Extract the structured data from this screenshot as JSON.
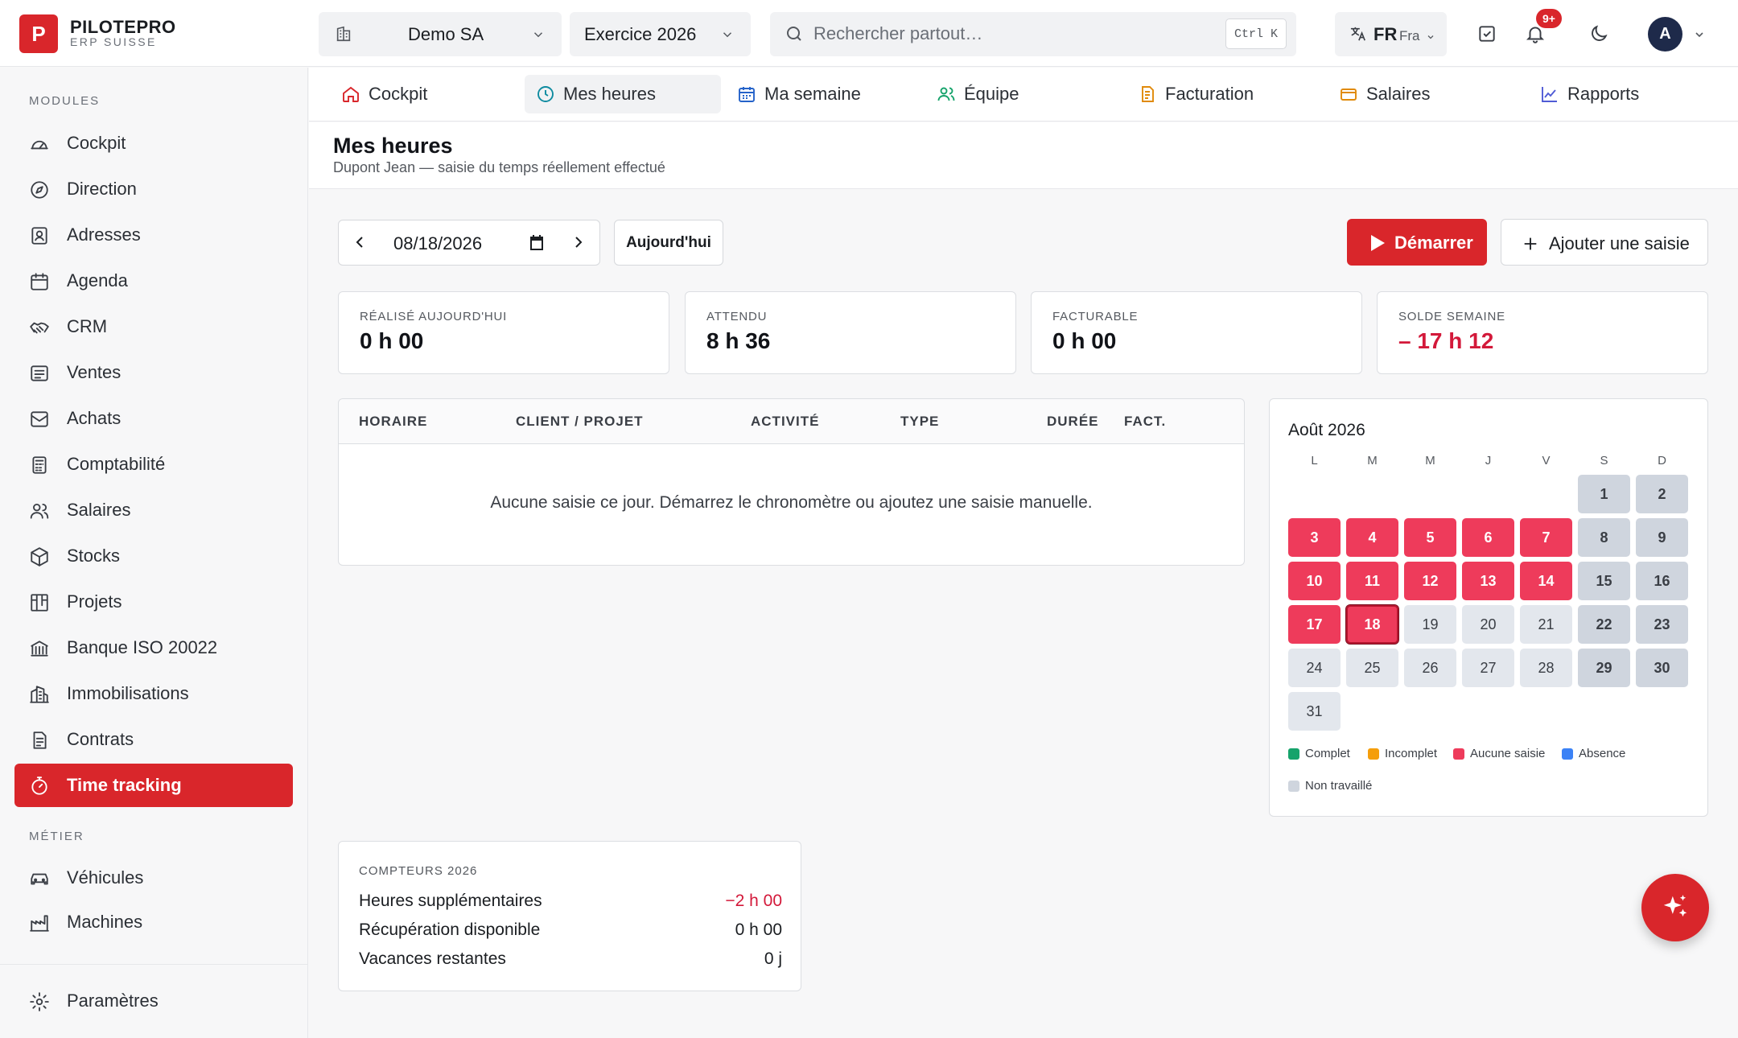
{
  "brand": {
    "logo_letter": "P",
    "name": "PILOTEPRO",
    "subtitle": "ERP SUISSE"
  },
  "topbar": {
    "company": "Demo SA",
    "fiscal_year": "Exercice 2026",
    "search_placeholder": "Rechercher partout…",
    "search_shortcut": "Ctrl K",
    "lang_code": "FR",
    "lang_name": "Fra",
    "notifications_badge": "9+",
    "avatar_initial": "A"
  },
  "sidebar": {
    "section_modules": "MODULES",
    "modules": [
      {
        "label": "Cockpit",
        "icon": "gauge-icon"
      },
      {
        "label": "Direction",
        "icon": "compass-icon"
      },
      {
        "label": "Adresses",
        "icon": "contact-card-icon"
      },
      {
        "label": "Agenda",
        "icon": "calendar-icon"
      },
      {
        "label": "CRM",
        "icon": "handshake-icon"
      },
      {
        "label": "Ventes",
        "icon": "receipt-icon"
      },
      {
        "label": "Achats",
        "icon": "inbox-icon"
      },
      {
        "label": "Comptabilité",
        "icon": "calculator-icon"
      },
      {
        "label": "Salaires",
        "icon": "users-icon"
      },
      {
        "label": "Stocks",
        "icon": "box-icon"
      },
      {
        "label": "Projets",
        "icon": "kanban-icon"
      },
      {
        "label": "Banque ISO 20022",
        "icon": "bank-icon"
      },
      {
        "label": "Immobilisations",
        "icon": "buildings-icon"
      },
      {
        "label": "Contrats",
        "icon": "contract-icon"
      },
      {
        "label": "Time tracking",
        "icon": "stopwatch-icon",
        "active": true
      }
    ],
    "section_metier": "MÉTIER",
    "metier": [
      {
        "label": "Véhicules",
        "icon": "car-icon"
      },
      {
        "label": "Machines",
        "icon": "factory-icon"
      }
    ],
    "settings": "Paramètres"
  },
  "tabs": [
    {
      "label": "Cockpit",
      "icon": "home-icon"
    },
    {
      "label": "Mes heures",
      "icon": "clock-icon",
      "active": true
    },
    {
      "label": "Ma semaine",
      "icon": "calendar-icon"
    },
    {
      "label": "Équipe",
      "icon": "users-icon"
    },
    {
      "label": "Facturation",
      "icon": "document-icon"
    },
    {
      "label": "Salaires",
      "icon": "wallet-icon"
    },
    {
      "label": "Rapports",
      "icon": "chart-line-icon"
    }
  ],
  "page": {
    "title": "Mes heures",
    "subtitle": "Dupont Jean — saisie du temps réellement effectué"
  },
  "toolbar": {
    "date": "08/18/2026",
    "today_label": "Aujourd'hui",
    "start_label": "Démarrer",
    "add_label": "Ajouter une saisie"
  },
  "kpis": [
    {
      "label": "RÉALISÉ AUJOURD'HUI",
      "value": "0 h 00",
      "negative": false
    },
    {
      "label": "ATTENDU",
      "value": "8 h 36",
      "negative": false
    },
    {
      "label": "FACTURABLE",
      "value": "0 h 00",
      "negative": false
    },
    {
      "label": "SOLDE SEMAINE",
      "value": "– 17 h 12",
      "negative": true
    }
  ],
  "entries": {
    "columns": [
      "HORAIRE",
      "CLIENT / PROJET",
      "ACTIVITÉ",
      "TYPE",
      "DURÉE",
      "FACT."
    ],
    "empty_message": "Aucune saisie ce jour. Démarrez le chronomètre ou ajoutez une saisie manuelle."
  },
  "calendar": {
    "title": "Août 2026",
    "weekdays": [
      "L",
      "M",
      "M",
      "J",
      "V",
      "S",
      "D"
    ],
    "first_weekday_index": 5,
    "days_in_month": 31,
    "selected_day": 18,
    "missing_days": [
      3,
      4,
      5,
      6,
      7,
      10,
      11,
      12,
      13,
      14,
      17,
      18
    ],
    "legend": [
      {
        "label": "Complet",
        "color": "#16a36b"
      },
      {
        "label": "Incomplet",
        "color": "#f59e0b"
      },
      {
        "label": "Aucune saisie",
        "color": "#ee3b5b"
      },
      {
        "label": "Absence",
        "color": "#3b82f6"
      },
      {
        "label": "Non travaillé",
        "color": "#cfd5de"
      }
    ]
  },
  "counters": {
    "title": "COMPTEURS 2026",
    "rows": [
      {
        "label": "Heures supplémentaires",
        "value": "−2 h 00",
        "negative": true
      },
      {
        "label": "Récupération disponible",
        "value": "0 h 00",
        "negative": false
      },
      {
        "label": "Vacances restantes",
        "value": "0 j",
        "negative": false
      }
    ]
  },
  "colors": {
    "accent": "#d9262b",
    "missing": "#ee3b5b",
    "negative": "#d3193a"
  }
}
